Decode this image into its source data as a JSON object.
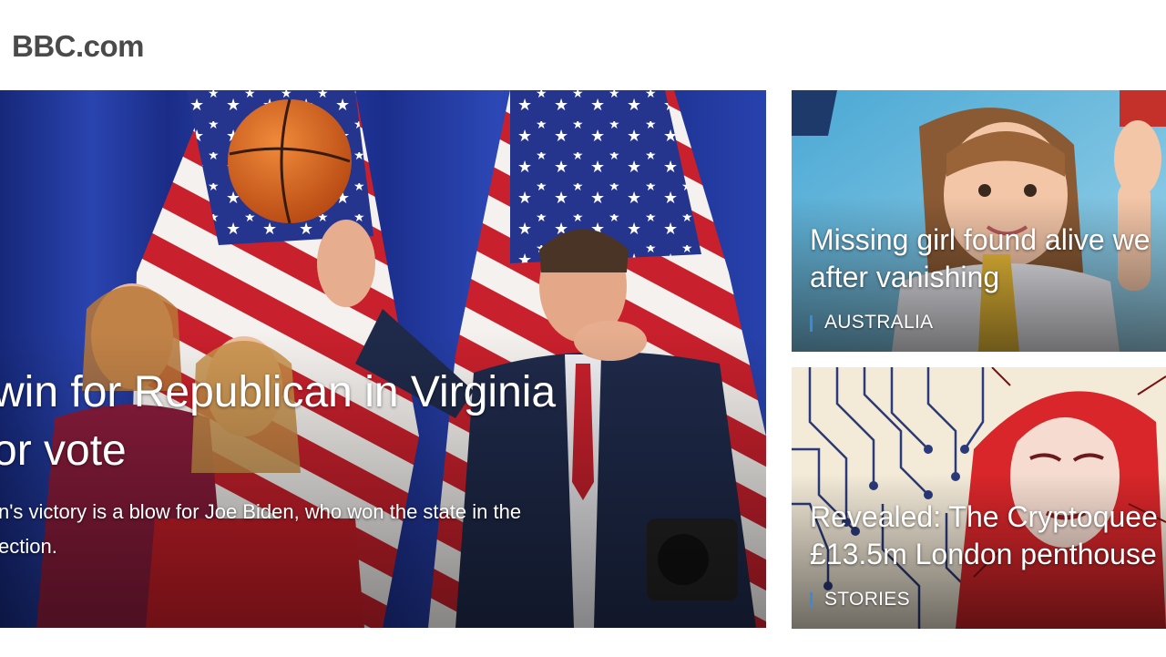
{
  "header": {
    "site_title": "BBC.com"
  },
  "lead_story": {
    "headline_line1": "win for Republican in Virginia",
    "headline_line2": "or vote",
    "summary_line1": "n's victory is a blow for Joe Biden, who won the state in the",
    "summary_line2": "ection."
  },
  "side_stories": [
    {
      "title_line1": "Missing girl found alive we",
      "title_line2": "after vanishing",
      "tag": "AUSTRALIA"
    },
    {
      "title_line1": "Revealed: The Cryptoquee",
      "title_line2": "£13.5m London penthouse",
      "tag": "STORIES"
    }
  ],
  "colors": {
    "title_text": "#4a4a4a",
    "tag_accent": "#3a8ad8",
    "flag_red": "#c8202c",
    "flag_blue": "#25358e"
  }
}
